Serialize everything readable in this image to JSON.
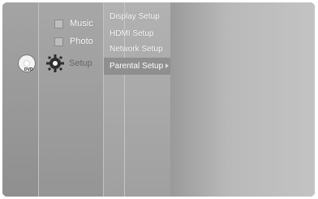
{
  "app": {
    "disc_label": "DVD"
  },
  "menu": {
    "music": "Music",
    "photo": "Photo",
    "setup": "Setup"
  },
  "submenu": {
    "display": "Display Setup",
    "hdmi": "HDMI Setup",
    "network": "Network Setup",
    "parental": "Parental Setup"
  },
  "icons": {
    "music": "music-icon",
    "photo": "photo-icon",
    "setup": "gear-icon",
    "disc": "disc-icon",
    "arrow": "chevron-right-icon"
  }
}
